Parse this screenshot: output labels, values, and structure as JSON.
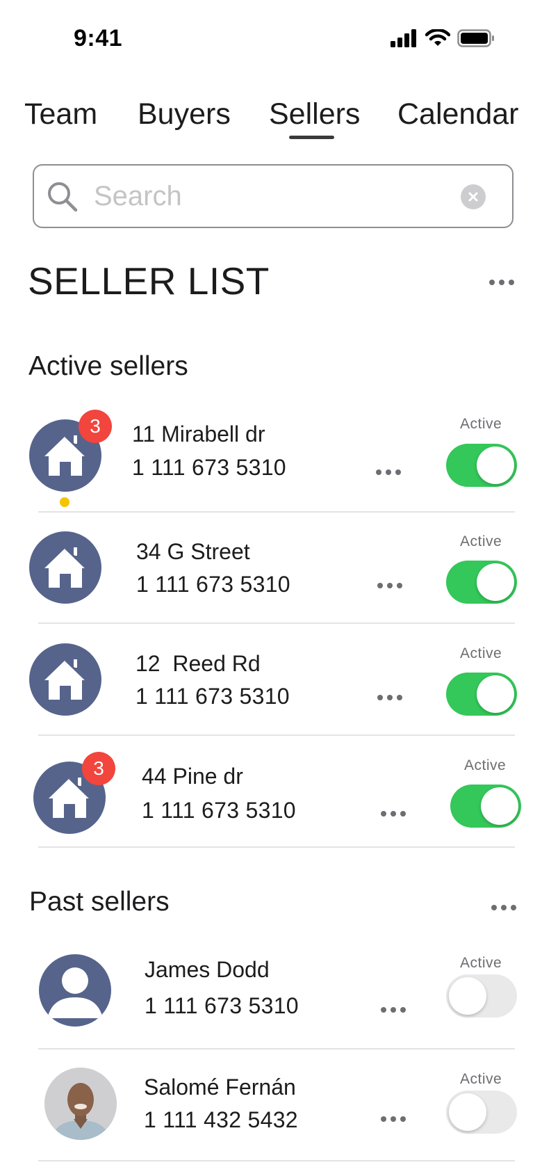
{
  "status_bar": {
    "time": "9:41"
  },
  "tabs": [
    {
      "label": "Team"
    },
    {
      "label": "Buyers"
    },
    {
      "label": "Sellers",
      "selected": true
    },
    {
      "label": "Calendar"
    }
  ],
  "search": {
    "placeholder": "Search",
    "value": ""
  },
  "page_title": "SELLER LIST",
  "active_section": {
    "title": "Active sellers",
    "rows": [
      {
        "title": "11 Mirabell dr",
        "phone": "1 111 673 5310",
        "status_label": "Active",
        "badge": "3",
        "active": true,
        "icon": "house-icon"
      },
      {
        "title": "34 G Street",
        "phone": "1 111 673 5310",
        "status_label": "Active",
        "active": true,
        "icon": "house-icon"
      },
      {
        "title": "12  Reed Rd",
        "phone": "1 111 673 5310",
        "status_label": "Active",
        "active": true,
        "icon": "house-icon"
      },
      {
        "title": "44 Pine dr",
        "phone": "1 111 673 5310",
        "status_label": "Active",
        "badge": "3",
        "active": true,
        "icon": "house-icon"
      }
    ]
  },
  "past_section": {
    "title": "Past sellers",
    "rows": [
      {
        "title": "James Dodd",
        "phone": "1 111 673 5310",
        "status_label": "Active",
        "active": false,
        "icon": "person-icon"
      },
      {
        "title": "Salomé Fernán",
        "phone": "1 111 432 5432",
        "status_label": "Active",
        "active": false,
        "icon": "profile-photo"
      }
    ]
  },
  "colors": {
    "toggle_on": "#34c759",
    "avatar": "#56648c",
    "badge": "#f2453d",
    "unread_dot": "#f5c400"
  }
}
